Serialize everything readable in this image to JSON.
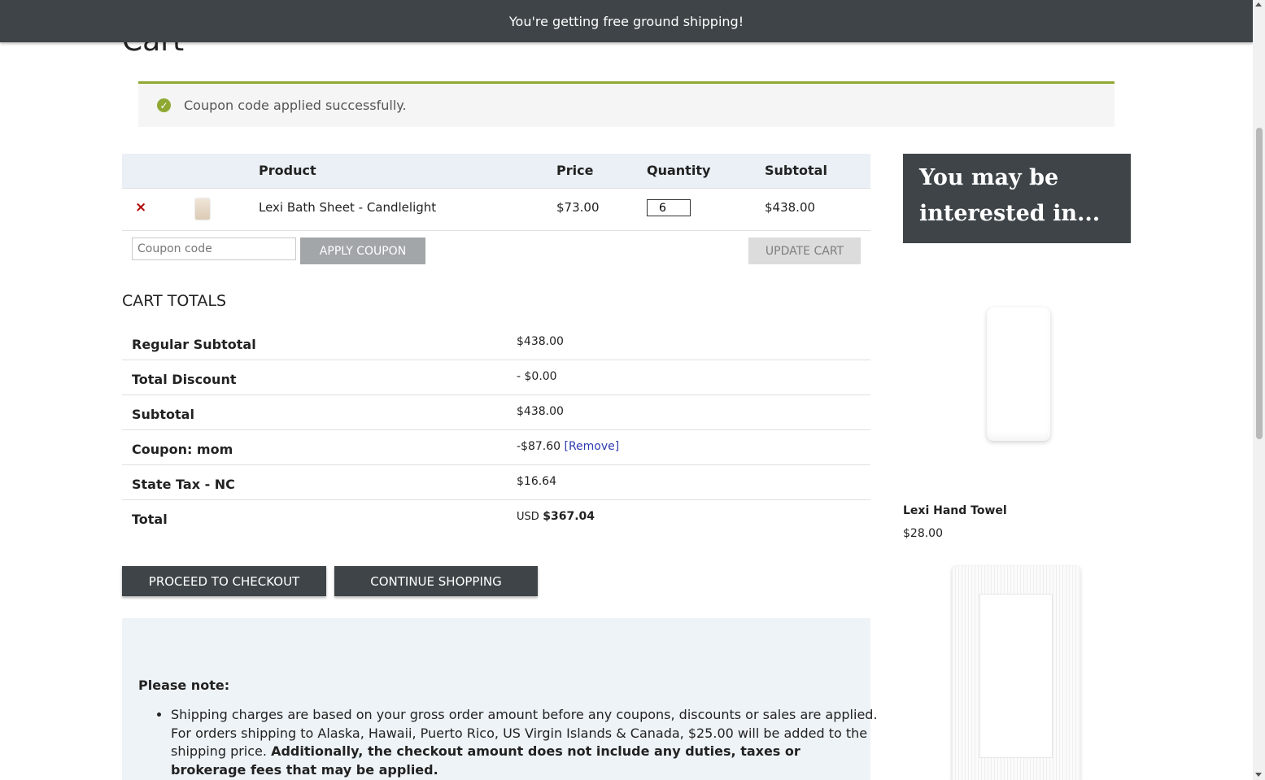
{
  "banner": {
    "text": "You're getting free ground shipping!"
  },
  "page": {
    "title": "Cart"
  },
  "notice": {
    "icon": "check-circle-icon",
    "message": "Coupon code applied successfully."
  },
  "cart": {
    "headers": {
      "product": "Product",
      "price": "Price",
      "quantity": "Quantity",
      "subtotal": "Subtotal"
    },
    "items": [
      {
        "remove": "×",
        "name": "Lexi Bath Sheet - Candlelight",
        "price": "$73.00",
        "quantity": "6",
        "subtotal": "$438.00"
      }
    ],
    "coupon_placeholder": "Coupon code",
    "apply_coupon_label": "APPLY COUPON",
    "update_cart_label": "UPDATE CART"
  },
  "totals": {
    "title": "CART TOTALS",
    "rows": [
      {
        "label": "Regular Subtotal",
        "value": "$438.00"
      },
      {
        "label": "Total Discount",
        "value": "- $0.00"
      },
      {
        "label": "Subtotal",
        "value": "$438.00"
      },
      {
        "label": "Coupon: mom",
        "value": "-$87.60",
        "link": "[Remove]"
      },
      {
        "label": "State Tax - NC",
        "value": "$16.64"
      },
      {
        "label": "Total",
        "currency": "USD",
        "value": "$367.04"
      }
    ]
  },
  "actions": {
    "checkout_label": "PROCEED TO CHECKOUT",
    "continue_label": "CONTINUE SHOPPING"
  },
  "note": {
    "title": "Please note:",
    "text": "Shipping charges are based on your gross order amount before any coupons, discounts or sales are applied. For orders shipping to Alaska, Hawaii, Puerto Rico, US Virgin Islands & Canada, $25.00 will be added to the shipping price.",
    "bold_text": "Additionally, the checkout amount does not include any duties, taxes or brokerage fees that may be applied."
  },
  "sidebar": {
    "title": "You may be interested in...",
    "products": [
      {
        "name": "Lexi Hand Towel",
        "price": "$28.00"
      }
    ]
  },
  "colors": {
    "banner": "#3e4447",
    "accent_green": "#8fa832",
    "table_header": "#eaf0f5",
    "remove_red": "#b00000",
    "link_blue": "#2c3ab0"
  }
}
